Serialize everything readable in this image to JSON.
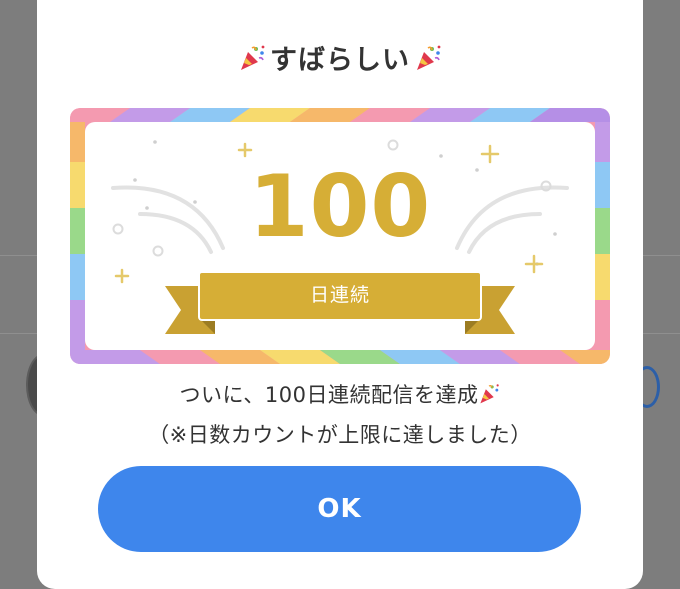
{
  "dialog": {
    "title": "すばらしい",
    "title_icon": "party-popper-icon",
    "badge": {
      "count": "100",
      "ribbon_label": "日連続"
    },
    "message_line1": "ついに、100日連続配信を達成",
    "message_line2": "（※日数カウントが上限に達しました）",
    "ok_label": "OK"
  },
  "colors": {
    "gold": "#d6ae36",
    "button_blue": "#3e86ec",
    "text": "#333333",
    "backdrop": "#7d7d7d"
  }
}
